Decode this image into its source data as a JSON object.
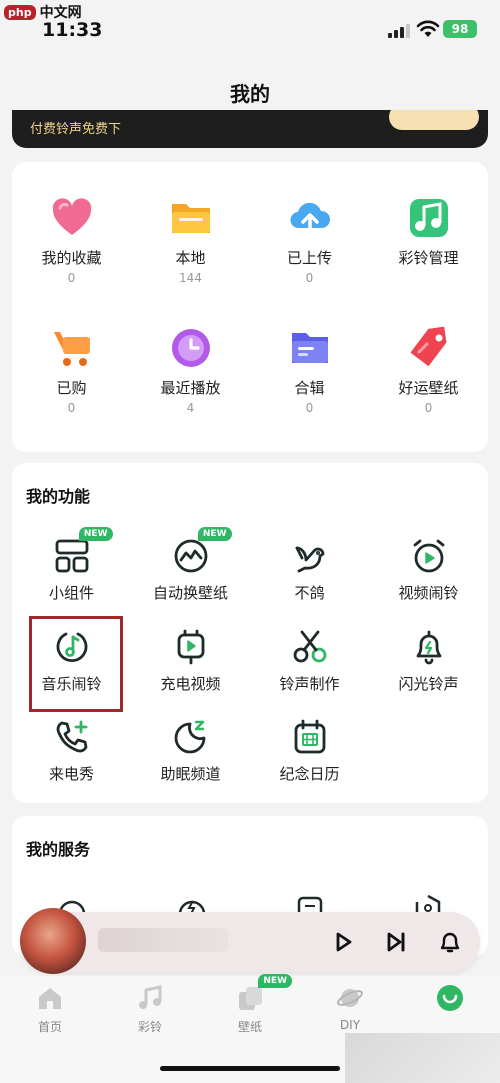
{
  "watermark": {
    "badge": "php",
    "text": "中文网"
  },
  "status": {
    "time": "11:33",
    "battery": "98"
  },
  "page": {
    "title": "我的"
  },
  "banner": {
    "text": "付费铃声免费下"
  },
  "library": {
    "items": [
      {
        "label": "我的收藏",
        "count": "0",
        "icon": "heart-icon"
      },
      {
        "label": "本地",
        "count": "144",
        "icon": "folder-icon"
      },
      {
        "label": "已上传",
        "count": "0",
        "icon": "cloud-upload-icon"
      },
      {
        "label": "彩铃管理",
        "count": "",
        "icon": "music-note-icon"
      },
      {
        "label": "已购",
        "count": "0",
        "icon": "cart-icon"
      },
      {
        "label": "最近播放",
        "count": "4",
        "icon": "clock-icon"
      },
      {
        "label": "合辑",
        "count": "0",
        "icon": "album-icon"
      },
      {
        "label": "好运壁纸",
        "count": "0",
        "icon": "tag-icon"
      }
    ]
  },
  "functions": {
    "title": "我的功能",
    "new_badge": "NEW",
    "items": [
      {
        "label": "小组件",
        "icon": "widget-icon",
        "badge": true
      },
      {
        "label": "自动换壁纸",
        "icon": "auto-wallpaper-icon",
        "badge": true
      },
      {
        "label": "不鸽",
        "icon": "dove-icon",
        "badge": false
      },
      {
        "label": "视频闹铃",
        "icon": "video-alarm-icon",
        "badge": false
      },
      {
        "label": "音乐闹铃",
        "icon": "music-alarm-icon",
        "badge": false
      },
      {
        "label": "充电视频",
        "icon": "charging-video-icon",
        "badge": false
      },
      {
        "label": "铃声制作",
        "icon": "scissors-icon",
        "badge": false
      },
      {
        "label": "闪光铃声",
        "icon": "flash-bell-icon",
        "badge": false
      },
      {
        "label": "来电秀",
        "icon": "phone-plus-icon",
        "badge": false
      },
      {
        "label": "助眠频道",
        "icon": "sleep-moon-icon",
        "badge": false
      },
      {
        "label": "纪念日历",
        "icon": "calendar-icon",
        "badge": false
      }
    ]
  },
  "services": {
    "title": "我的服务"
  },
  "tabs": [
    {
      "label": "首页",
      "icon": "home-icon"
    },
    {
      "label": "彩铃",
      "icon": "music-icon"
    },
    {
      "label": "壁纸",
      "icon": "wallpaper-icon",
      "badge": "NEW"
    },
    {
      "label": "DIY",
      "icon": "planet-icon"
    },
    {
      "label": "",
      "icon": "profile-icon"
    }
  ],
  "colors": {
    "accent": "#2fb764",
    "icon_dark": "#1f2a2a",
    "highlight": "#a4282a",
    "banner_bg": "#1e1e1e"
  }
}
